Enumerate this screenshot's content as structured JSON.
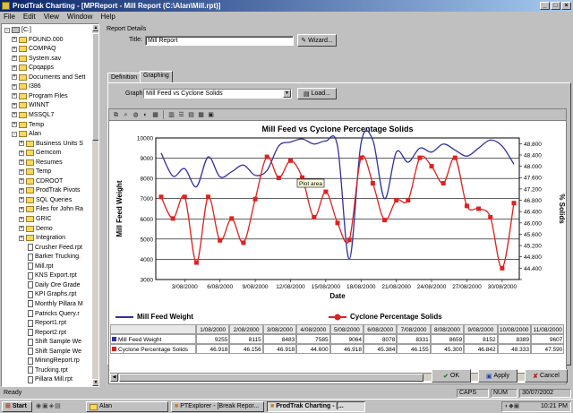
{
  "window": {
    "title": "ProdTrak Charting - [MPReport - Mill Report (C:\\Alan\\Mill.rpt)]"
  },
  "menu": [
    "File",
    "Edit",
    "View",
    "Window",
    "Help"
  ],
  "tree": {
    "items": [
      {
        "label": "[C:]",
        "icon": "drive-icon",
        "exp": "-",
        "depth": 0
      },
      {
        "label": "FOUND.000",
        "icon": "folder-icon",
        "exp": "+",
        "depth": 1
      },
      {
        "label": "COMPAQ",
        "icon": "folder-icon",
        "exp": "+",
        "depth": 1
      },
      {
        "label": "System.sav",
        "icon": "folder-icon",
        "exp": "+",
        "depth": 1
      },
      {
        "label": "Cpqapps",
        "icon": "folder-icon",
        "exp": "+",
        "depth": 1
      },
      {
        "label": "Documents and Sett",
        "icon": "folder-icon",
        "exp": "+",
        "depth": 1
      },
      {
        "label": "I386",
        "icon": "folder-icon",
        "exp": "+",
        "depth": 1
      },
      {
        "label": "Program Files",
        "icon": "folder-icon",
        "exp": "+",
        "depth": 1
      },
      {
        "label": "WINNT",
        "icon": "folder-icon",
        "exp": "+",
        "depth": 1
      },
      {
        "label": "MSSQL7",
        "icon": "folder-icon",
        "exp": "+",
        "depth": 1
      },
      {
        "label": "Temp",
        "icon": "folder-icon",
        "exp": "+",
        "depth": 1
      },
      {
        "label": "Alan",
        "icon": "folder-icon",
        "exp": "-",
        "depth": 1
      },
      {
        "label": "Business Units S",
        "icon": "folder-icon",
        "exp": "+",
        "depth": 2
      },
      {
        "label": "Gemcom",
        "icon": "folder-icon",
        "exp": "+",
        "depth": 2
      },
      {
        "label": "Resumes",
        "icon": "folder-icon",
        "exp": "+",
        "depth": 2
      },
      {
        "label": "Temp",
        "icon": "folder-icon",
        "exp": "+",
        "depth": 2
      },
      {
        "label": "CDROOT",
        "icon": "folder-icon",
        "exp": "+",
        "depth": 2
      },
      {
        "label": "ProdTrak Pivots",
        "icon": "folder-icon",
        "exp": "+",
        "depth": 2
      },
      {
        "label": "SQL Queries",
        "icon": "folder-icon",
        "exp": "+",
        "depth": 2
      },
      {
        "label": "Files for John Ra",
        "icon": "folder-icon",
        "exp": "+",
        "depth": 2
      },
      {
        "label": "GRIC",
        "icon": "folder-icon",
        "exp": "+",
        "depth": 2
      },
      {
        "label": "Demo",
        "icon": "folder-icon",
        "exp": "+",
        "depth": 2
      },
      {
        "label": "Integration",
        "icon": "folder-icon",
        "exp": "+",
        "depth": 2
      },
      {
        "label": "Crusher Feed.rpt",
        "icon": "file-icon",
        "exp": "",
        "depth": 2
      },
      {
        "label": "Barker Trucking.",
        "icon": "file-icon",
        "exp": "",
        "depth": 2
      },
      {
        "label": "Mill.rpt",
        "icon": "file-icon",
        "exp": "",
        "depth": 2
      },
      {
        "label": "KNS Export.rpt",
        "icon": "file-icon",
        "exp": "",
        "depth": 2
      },
      {
        "label": "Daily Ore Grade",
        "icon": "file-icon",
        "exp": "",
        "depth": 2
      },
      {
        "label": "KPI Graphs.rpt",
        "icon": "file-icon",
        "exp": "",
        "depth": 2
      },
      {
        "label": "Monthly Pillara M",
        "icon": "file-icon",
        "exp": "",
        "depth": 2
      },
      {
        "label": "Patricks Query.r",
        "icon": "file-icon",
        "exp": "",
        "depth": 2
      },
      {
        "label": "Report1.rpt",
        "icon": "file-icon",
        "exp": "",
        "depth": 2
      },
      {
        "label": "Report2.rpt",
        "icon": "file-icon",
        "exp": "",
        "depth": 2
      },
      {
        "label": "Shift Sample We",
        "icon": "file-icon",
        "exp": "",
        "depth": 2
      },
      {
        "label": "Shift Sample We",
        "icon": "file-icon",
        "exp": "",
        "depth": 2
      },
      {
        "label": "MiningReport.rp",
        "icon": "file-icon",
        "exp": "",
        "depth": 2
      },
      {
        "label": "Trucking.rpt",
        "icon": "file-icon",
        "exp": "",
        "depth": 2
      },
      {
        "label": "Pillara Mill.rpt",
        "icon": "file-icon",
        "exp": "",
        "depth": 2
      }
    ]
  },
  "report": {
    "group_label": "Report Details",
    "title_label": "Title:",
    "title_value": "Mill Report",
    "wizard_label": "Wizard...",
    "tabs": [
      "Definition",
      "Graphing"
    ],
    "graph_label": "Graph:",
    "graph_value": "Mill Feed vs Cyclone Solids",
    "load_label": "Load..."
  },
  "chart_data": {
    "type": "line",
    "title": "Mill Feed vs Cyclone Percentage Solids",
    "xlabel": "Date",
    "ylabel": "Mill Feed Weight",
    "y2label": "% Solids",
    "x_ticks": [
      "3/08/2000",
      "6/08/2000",
      "9/08/2000",
      "12/08/2000",
      "15/08/2000",
      "18/08/2000",
      "21/08/2000",
      "24/08/2000",
      "27/08/2000",
      "30/08/2000"
    ],
    "ylim": [
      3000,
      10000
    ],
    "y_ticks": [
      3000,
      4000,
      5000,
      6000,
      7000,
      8000,
      9000,
      10000
    ],
    "y2lim": [
      44.0,
      49.0
    ],
    "y2_ticks": [
      44.0,
      44.4,
      44.8,
      45.2,
      45.6,
      46.0,
      46.4,
      46.8,
      47.2,
      47.6,
      48.0,
      48.4,
      48.8
    ],
    "y2_tick_labels": [
      "",
      "44.400",
      "44.800",
      "45.200",
      "45.600",
      "46.000",
      "46.400",
      "46.800",
      "47.200",
      "47.600",
      "48.000",
      "48.400",
      "48.800"
    ],
    "series": [
      {
        "name": "Mill Feed Weight",
        "color": "#3030a0",
        "axis": "left",
        "values": [
          9255,
          8115,
          8483,
          7585,
          9064,
          8078,
          8331,
          8659,
          8152,
          8389,
          9607,
          9800,
          9950,
          9700,
          9850,
          9600,
          4000,
          9750,
          9900,
          7000,
          9300,
          8800,
          9500,
          9300,
          9700,
          9400,
          9100,
          9500,
          9900,
          9600,
          8700
        ]
      },
      {
        "name": "Cyclone Percentage Solids",
        "color": "#e02020",
        "axis": "right",
        "values": [
          46.918,
          46.156,
          46.918,
          44.6,
          46.918,
          45.384,
          46.155,
          45.3,
          46.842,
          48.333,
          47.59,
          48.2,
          47.6,
          46.2,
          47.1,
          46.0,
          45.4,
          48.3,
          47.4,
          46.1,
          46.8,
          46.8,
          48.3,
          48.0,
          47.4,
          48.3,
          46.6,
          46.5,
          46.2,
          44.4,
          46.7
        ]
      }
    ],
    "legend": [
      "Mill Feed Weight",
      "Cyclone Percentage Solids"
    ],
    "grid": true
  },
  "table": {
    "columns": [
      "1/08/2000",
      "2/08/2000",
      "3/08/2000",
      "4/08/2000",
      "5/08/2000",
      "6/08/2000",
      "7/08/2000",
      "8/08/2000",
      "9/08/2000",
      "10/08/2000",
      "11/08/2000"
    ],
    "rows": [
      {
        "label": "Mill Feed Weight",
        "values": [
          "9255",
          "8115",
          "8483",
          "7585",
          "9064",
          "8078",
          "8331",
          "8659",
          "8152",
          "8389",
          "9607"
        ]
      },
      {
        "label": "Cyclone Percentage Solids",
        "values": [
          "46.918",
          "46.156",
          "46.918",
          "44.600",
          "46.918",
          "45.384",
          "46.155",
          "45.300",
          "46.842",
          "48.333",
          "47.590"
        ]
      }
    ]
  },
  "buttons": {
    "ok": "OK",
    "apply": "Apply",
    "cancel": "Cancel"
  },
  "status": {
    "text": "Ready",
    "caps": "CAPS",
    "num": "NUM",
    "date": "30/07/2002"
  },
  "taskbar": {
    "start": "Start",
    "items": [
      "Alan",
      "PTExplorer - [Break Repor...",
      "ProdTrak Charting - [..."
    ],
    "time": "10:21 PM"
  }
}
